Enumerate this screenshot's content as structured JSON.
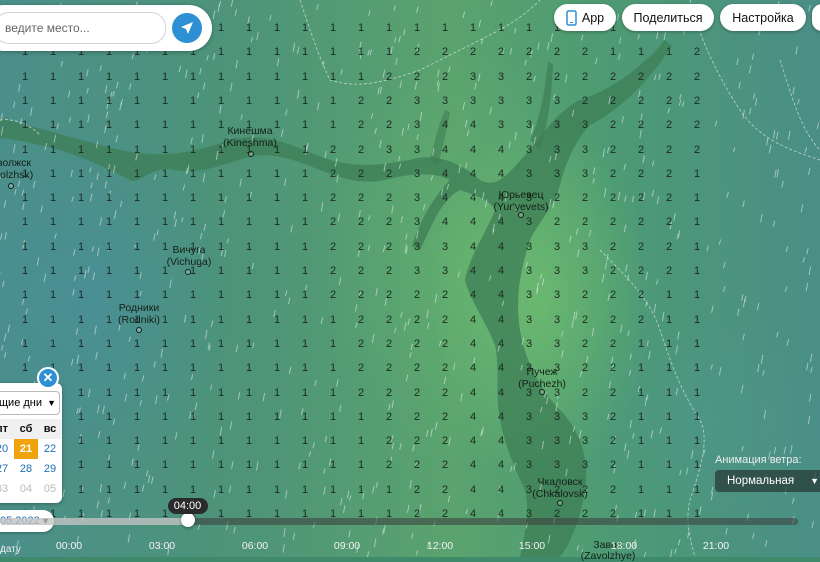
{
  "search": {
    "placeholder": "ведите место..."
  },
  "buttons": {
    "app": "App",
    "share": "Поделиться",
    "settings": "Настройка"
  },
  "cities": [
    {
      "name": "Кинешма",
      "latin": "(Kineshma)"
    },
    {
      "name": "волжск",
      "latin": "volzhsk)"
    },
    {
      "name": "Вичуга",
      "latin": "(Vichuga)"
    },
    {
      "name": "Родники",
      "latin": "(Rodniki)"
    },
    {
      "name": "Юрьевец",
      "latin": "(Yur'yevets)"
    },
    {
      "name": "Пучеж",
      "latin": "(Puchezh)"
    },
    {
      "name": "Чкаловск",
      "latin": "(Chkalovsk)"
    },
    {
      "name": "Завол",
      "latin": "(Zavolzhye)"
    }
  ],
  "calendar": {
    "mode": "щие дни",
    "weekdays": [
      "пт",
      "сб",
      "вс"
    ],
    "weeks": [
      [
        "20",
        "21",
        "22"
      ],
      [
        "27",
        "28",
        "29"
      ],
      [
        "03",
        "04",
        "05"
      ]
    ],
    "selected": "21",
    "date": "05.2022"
  },
  "timeline": {
    "current": "04:00",
    "progress": 0.235,
    "hours": [
      "00:00",
      "03:00",
      "06:00",
      "09:00",
      "12:00",
      "15:00",
      "18:00",
      "21:00"
    ],
    "caption": "дату"
  },
  "wind": {
    "label": "Анимация ветра:",
    "value": "Нормальная"
  },
  "colors": {
    "accent": "#2d8fd4",
    "selected_day": "#f0a30a"
  },
  "precip_grid": [
    "1111111111111111111111112",
    "1111111111111122222221112",
    "1111111111111222332222222",
    "1111111111112233333322222",
    "1111111111112234433332222",
    "1111111111122334443332222",
    "1111111111122234443332221",
    "1111111111122234443222221",
    "1111111111122234443222221",
    "1111111111122233443332221",
    "1111111111122233443332221",
    "1111111111122222443322211",
    "1111111111112222443322211",
    "1111111111112222443322111",
    "1111111111112222443322111",
    "1111111111112222443322111",
    "1111111111111222443332111",
    "1111111111111222443332111",
    "1111111111111222443332111",
    "1111111111111122443222111",
    "1111111111111122443222111"
  ]
}
